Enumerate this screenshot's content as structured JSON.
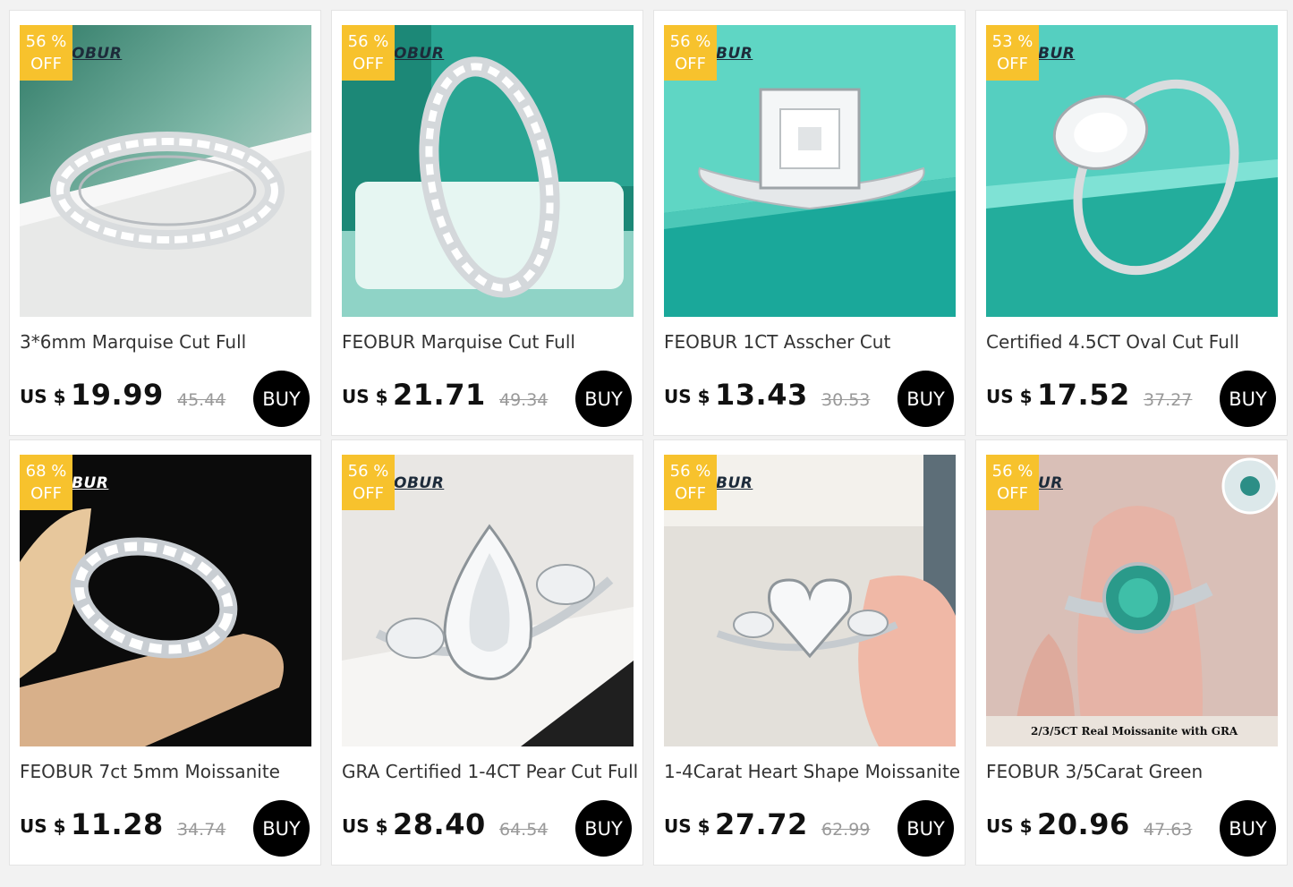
{
  "products": [
    {
      "discount_pct": "56  %",
      "discount_off": "OFF",
      "brand_watermark": "OBUR",
      "title": "3*6mm Marquise Cut Full",
      "currency": "US $",
      "price": "19.99",
      "original_price": "45.44",
      "buy_label": "BUY",
      "image_icon": "marquise-eternity-ring-image"
    },
    {
      "discount_pct": "56  %",
      "discount_off": "OFF",
      "brand_watermark": "OBUR",
      "title": "FEOBUR Marquise Cut Full",
      "currency": "US $",
      "price": "21.71",
      "original_price": "49.34",
      "buy_label": "BUY",
      "image_icon": "marquise-ring-on-box-image"
    },
    {
      "discount_pct": "56  %",
      "discount_off": "OFF",
      "brand_watermark": "BUR",
      "title": "FEOBUR 1CT Asscher Cut",
      "currency": "US $",
      "price": "13.43",
      "original_price": "30.53",
      "buy_label": "BUY",
      "image_icon": "asscher-solitaire-ring-image"
    },
    {
      "discount_pct": "53  %",
      "discount_off": "OFF",
      "brand_watermark": "BUR",
      "title": "Certified 4.5CT Oval Cut Full",
      "currency": "US $",
      "price": "17.52",
      "original_price": "37.27",
      "buy_label": "BUY",
      "image_icon": "oval-solitaire-ring-image"
    },
    {
      "discount_pct": "68  %",
      "discount_off": "OFF",
      "brand_watermark": "BUR",
      "title": "FEOBUR 7ct 5mm Moissanite",
      "currency": "US $",
      "price": "11.28",
      "original_price": "34.74",
      "buy_label": "BUY",
      "image_icon": "eternity-band-in-hand-image"
    },
    {
      "discount_pct": "56  %",
      "discount_off": "OFF",
      "brand_watermark": "OBUR",
      "title": "GRA Certified 1-4CT Pear Cut Full",
      "currency": "US $",
      "price": "28.40",
      "original_price": "64.54",
      "buy_label": "BUY",
      "image_icon": "pear-three-stone-ring-image"
    },
    {
      "discount_pct": "56  %",
      "discount_off": "OFF",
      "brand_watermark": "BUR",
      "title": "1-4Carat Heart Shape Moissanite",
      "currency": "US $",
      "price": "27.72",
      "original_price": "62.99",
      "buy_label": "BUY",
      "image_icon": "heart-ring-in-fingers-image"
    },
    {
      "discount_pct": "56  %",
      "discount_off": "OFF",
      "brand_watermark": "UR",
      "title": "FEOBUR 3/5Carat Green",
      "currency": "US $",
      "price": "20.96",
      "original_price": "47.63",
      "buy_label": "BUY",
      "image_icon": "green-moissanite-ring-on-finger-image",
      "image_caption": "2/3/5CT Real Moissanite with GRA"
    }
  ],
  "colors": {
    "badge": "#f7c22d",
    "buy_button": "#000000",
    "strikethrough": "#999999",
    "page_background": "#f2f2f2"
  }
}
